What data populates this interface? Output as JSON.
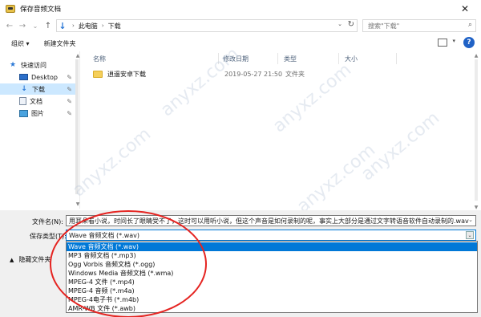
{
  "window": {
    "title": "保存音频文档",
    "close_glyph": "✕"
  },
  "nav": {
    "back": "←",
    "forward": "→",
    "history": "⌄",
    "up": "↑"
  },
  "address": {
    "crumbs": [
      "此电脑",
      "下载"
    ],
    "separator": "›",
    "dropdown": "⌄",
    "refresh": "↻"
  },
  "search": {
    "placeholder": "搜索\"下载\"",
    "icon": "⌕"
  },
  "toolbar": {
    "organize": "组织 ▾",
    "new_folder": "新建文件夹",
    "view_dropdown": "▾",
    "help": "?"
  },
  "sidebar": {
    "items": [
      {
        "label": "快速访问",
        "pinned": false
      },
      {
        "label": "Desktop",
        "pinned": true
      },
      {
        "label": "下载",
        "pinned": true,
        "selected": true
      },
      {
        "label": "文档",
        "pinned": true
      },
      {
        "label": "图片",
        "pinned": true
      }
    ],
    "pin_glyph": "📌"
  },
  "columns": {
    "name": "名称",
    "modified": "修改日期",
    "type": "类型",
    "size": "大小"
  },
  "files": [
    {
      "name": "逍遥安卓下载",
      "modified": "2019-05-27 21:50",
      "type": "文件夹",
      "size": ""
    }
  ],
  "footer": {
    "filename_label": "文件名(N):",
    "filename_value": "用耳朵看小说，时间长了眼睛受不了，这时可以用听小说，但这个声音是如何录制的呢，事实上大部分是通过文字转语音软件自动录制的.wav",
    "filetype_label": "保存类型(T):",
    "filetype_value": "Wave 音频文档 (*.wav)",
    "hide_folders": "隐藏文件夹",
    "dropdown_glyph": "⌄"
  },
  "filetype_options": [
    "Wave 音频文档 (*.wav)",
    "MP3 音频文档 (*.mp3)",
    "Ogg Vorbis 音频文档 (*.ogg)",
    "Windows Media 音频文档 (*.wma)",
    "MPEG-4 文件 (*.mp4)",
    "MPEG-4 音频 (*.m4a)",
    "MPEG-4电子书 (*.m4b)",
    "AMR-WB 文件 (*.awb)"
  ],
  "watermark": "anyxz.com",
  "colors": {
    "accent": "#0078d7",
    "selection": "#cce8ff",
    "annotation": "#e52421",
    "folder": "#f5cf5a"
  }
}
